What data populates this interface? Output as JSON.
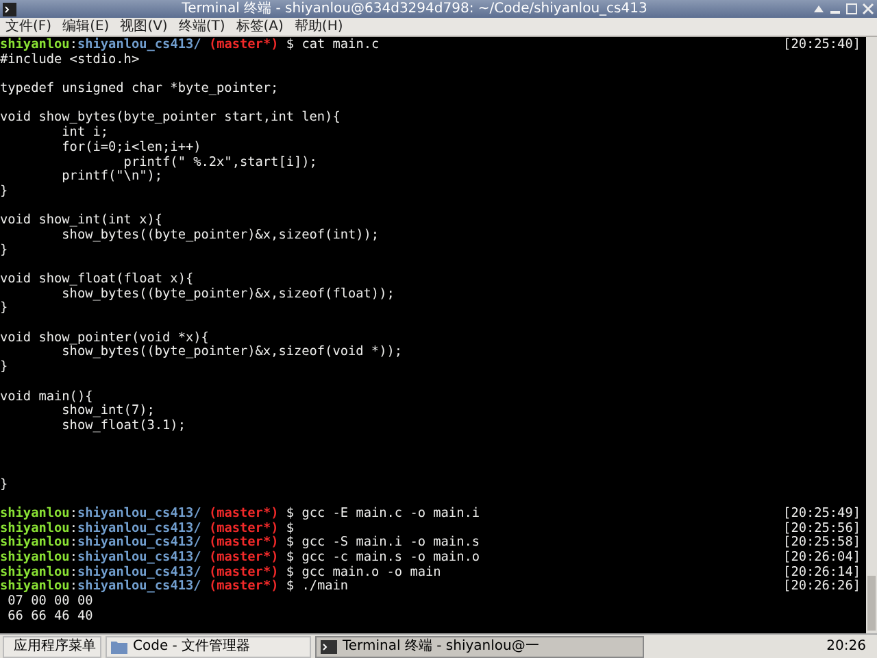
{
  "window": {
    "title": "Terminal 终端 - shiyanlou@634d3294d798: ~/Code/shiyanlou_cs413"
  },
  "menu": [
    "文件(F)",
    "编辑(E)",
    "视图(V)",
    "终端(T)",
    "标签(A)",
    "帮助(H)"
  ],
  "terminal_lines": [
    {
      "kind": "prompt",
      "user": "shiyanlou",
      "sep": ":",
      "path": "shiyanlou_cs413/",
      "branch": "(master*)",
      "command": "$ cat main.c",
      "time": "[20:25:40]"
    },
    {
      "kind": "output",
      "text": "#include <stdio.h>"
    },
    {
      "kind": "blank"
    },
    {
      "kind": "output",
      "text": "typedef unsigned char *byte_pointer;"
    },
    {
      "kind": "blank"
    },
    {
      "kind": "output",
      "text": "void show_bytes(byte_pointer start,int len){"
    },
    {
      "kind": "output",
      "text": "        int i;"
    },
    {
      "kind": "output",
      "text": "        for(i=0;i<len;i++)"
    },
    {
      "kind": "output",
      "text": "                printf(\" %.2x\",start[i]);"
    },
    {
      "kind": "output",
      "text": "        printf(\"\\n\");"
    },
    {
      "kind": "output",
      "text": "}"
    },
    {
      "kind": "blank"
    },
    {
      "kind": "output",
      "text": "void show_int(int x){"
    },
    {
      "kind": "output",
      "text": "        show_bytes((byte_pointer)&x,sizeof(int));"
    },
    {
      "kind": "output",
      "text": "}"
    },
    {
      "kind": "blank"
    },
    {
      "kind": "output",
      "text": "void show_float(float x){"
    },
    {
      "kind": "output",
      "text": "        show_bytes((byte_pointer)&x,sizeof(float));"
    },
    {
      "kind": "output",
      "text": "}"
    },
    {
      "kind": "blank"
    },
    {
      "kind": "output",
      "text": "void show_pointer(void *x){"
    },
    {
      "kind": "output",
      "text": "        show_bytes((byte_pointer)&x,sizeof(void *));"
    },
    {
      "kind": "output",
      "text": "}"
    },
    {
      "kind": "blank"
    },
    {
      "kind": "output",
      "text": "void main(){"
    },
    {
      "kind": "output",
      "text": "        show_int(7);"
    },
    {
      "kind": "output",
      "text": "        show_float(3.1);"
    },
    {
      "kind": "blank"
    },
    {
      "kind": "blank"
    },
    {
      "kind": "blank"
    },
    {
      "kind": "output",
      "text": "}"
    },
    {
      "kind": "blank"
    },
    {
      "kind": "prompt",
      "user": "shiyanlou",
      "sep": ":",
      "path": "shiyanlou_cs413/",
      "branch": "(master*)",
      "command": "$ gcc -E main.c -o main.i",
      "time": "[20:25:49]"
    },
    {
      "kind": "prompt",
      "user": "shiyanlou",
      "sep": ":",
      "path": "shiyanlou_cs413/",
      "branch": "(master*)",
      "command": "$",
      "time": "[20:25:56]"
    },
    {
      "kind": "prompt",
      "user": "shiyanlou",
      "sep": ":",
      "path": "shiyanlou_cs413/",
      "branch": "(master*)",
      "command": "$ gcc -S main.i -o main.s",
      "time": "[20:25:58]"
    },
    {
      "kind": "prompt",
      "user": "shiyanlou",
      "sep": ":",
      "path": "shiyanlou_cs413/",
      "branch": "(master*)",
      "command": "$ gcc -c main.s -o main.o",
      "time": "[20:26:04]"
    },
    {
      "kind": "prompt",
      "user": "shiyanlou",
      "sep": ":",
      "path": "shiyanlou_cs413/",
      "branch": "(master*)",
      "command": "$ gcc main.o -o main",
      "time": "[20:26:14]"
    },
    {
      "kind": "prompt",
      "user": "shiyanlou",
      "sep": ":",
      "path": "shiyanlou_cs413/",
      "branch": "(master*)",
      "command": "$ ./main",
      "time": "[20:26:26]"
    },
    {
      "kind": "output",
      "text": " 07 00 00 00"
    },
    {
      "kind": "output",
      "text": " 66 66 46 40"
    }
  ],
  "taskbar": {
    "items": [
      {
        "kind": "start",
        "label": "应用程序菜单",
        "selected": false
      },
      {
        "kind": "folder",
        "label": "Code - 文件管理器",
        "selected": false
      },
      {
        "kind": "terminal",
        "label": "Terminal 终端 - shiyanlou@一",
        "selected": true
      }
    ],
    "clock": "20:26"
  }
}
